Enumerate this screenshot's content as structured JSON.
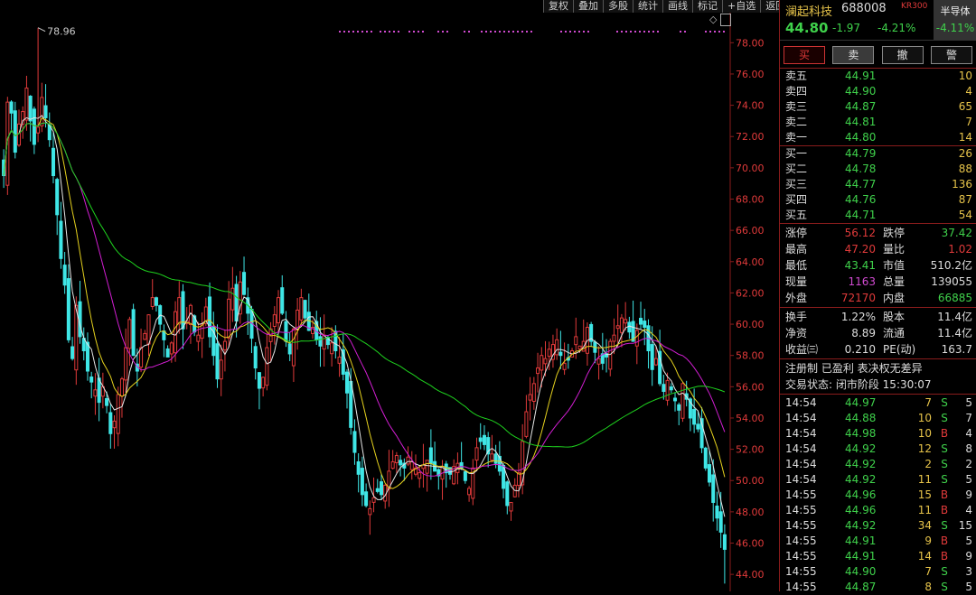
{
  "toolbar": [
    "复权",
    "叠加",
    "多股",
    "统计",
    "画线",
    "标记",
    "+自选",
    "返回"
  ],
  "chart_data": {
    "type": "candlestick",
    "y_ticks": [
      "78.00",
      "76.00",
      "74.00",
      "72.00",
      "70.00",
      "68.00",
      "66.00",
      "64.00",
      "62.00",
      "60.00",
      "58.00",
      "56.00",
      "54.00",
      "52.00",
      "50.00",
      "48.00",
      "46.00",
      "44.00"
    ],
    "ylim": [
      43.2,
      79.0
    ],
    "high_label": "78.96",
    "close": [
      69.5,
      74.2,
      73.5,
      71.0,
      72.8,
      73.6,
      75.1,
      73.0,
      71.5,
      72.6,
      74.5,
      73.2,
      71.8,
      69.5,
      67.0,
      64.2,
      62.5,
      59.0,
      57.8,
      61.2,
      59.2,
      58.3,
      57.0,
      56.3,
      55.8,
      55.0,
      56.0,
      54.8,
      53.0,
      53.8,
      55.5,
      56.5,
      58.5,
      60.3,
      58.0,
      57.0,
      58.5,
      59.4,
      60.6,
      61.7,
      61.2,
      60.0,
      59.0,
      57.9,
      58.8,
      60.8,
      61.7,
      59.7,
      60.2,
      61.2,
      59.5,
      59.3,
      60.0,
      61.1,
      59.2,
      58.0,
      56.5,
      57.7,
      58.9,
      61.6,
      62.3,
      60.2,
      62.7,
      61.9,
      60.7,
      59.1,
      57.2,
      55.9,
      56.6,
      58.5,
      59.7,
      60.6,
      61.7,
      60.7,
      58.9,
      58.1,
      59.7,
      60.9,
      61.7,
      60.4,
      59.6,
      59.8,
      59.0,
      58.6,
      59.3,
      58.7,
      58.8,
      58.3,
      57.9,
      56.8,
      55.6,
      53.4,
      51.8,
      50.4,
      49.1,
      48.4,
      48.2,
      48.9,
      49.3,
      49.1,
      49.7,
      50.6,
      51.2,
      51.6,
      51.0,
      50.8,
      51.5,
      51.2,
      50.8,
      50.5,
      51.0,
      51.3,
      51.1,
      50.6,
      50.3,
      50.9,
      50.5,
      50.4,
      50.9,
      51.1,
      50.8,
      50.0,
      49.5,
      50.8,
      52.1,
      52.5,
      52.3,
      51.7,
      51.7,
      51.1,
      50.6,
      49.5,
      48.4,
      48.6,
      49.7,
      50.5,
      52.5,
      54.4,
      55.5,
      56.2,
      57.2,
      58.0,
      57.8,
      58.4,
      58.7,
      59.0,
      58.0,
      57.5,
      57.7,
      58.3,
      59.2,
      58.6,
      58.9,
      59.8,
      58.9,
      58.2,
      57.8,
      57.5,
      57.9,
      58.9,
      59.3,
      59.9,
      60.4,
      60.3,
      59.5,
      58.9,
      59.6,
      60.0,
      59.8,
      58.3,
      57.1,
      57.8,
      56.2,
      55.7,
      56.4,
      55.8,
      55.1,
      54.5,
      56.2,
      55.2,
      54.0,
      53.6,
      53.3,
      52.1,
      50.8,
      49.9,
      48.6,
      47.6,
      46.7,
      45.6
    ],
    "ma_colors": {
      "ma5": "#e6e6e6",
      "ma10": "#e6d21e",
      "ma20": "#d21ed2",
      "ma60": "#1ed21e"
    },
    "colors": {
      "up": "#e03a3a",
      "down": "#3fe6e6"
    }
  },
  "panel": {
    "name": "澜起科技",
    "code": "688008",
    "tag": "KR300",
    "sector_name": "半导体",
    "sector_pct": "-4.11%",
    "price": "44.80",
    "change": "-1.97",
    "pct": "-4.21%",
    "buttons": [
      "买",
      "卖",
      "撤",
      "警"
    ],
    "asks": [
      {
        "label": "卖五",
        "price": "44.91",
        "vol": "10"
      },
      {
        "label": "卖四",
        "price": "44.90",
        "vol": "4"
      },
      {
        "label": "卖三",
        "price": "44.87",
        "vol": "65"
      },
      {
        "label": "卖二",
        "price": "44.81",
        "vol": "7"
      },
      {
        "label": "卖一",
        "price": "44.80",
        "vol": "14"
      }
    ],
    "bids": [
      {
        "label": "买一",
        "price": "44.79",
        "vol": "26"
      },
      {
        "label": "买二",
        "price": "44.78",
        "vol": "88"
      },
      {
        "label": "买三",
        "price": "44.77",
        "vol": "136"
      },
      {
        "label": "买四",
        "price": "44.76",
        "vol": "87"
      },
      {
        "label": "买五",
        "price": "44.71",
        "vol": "54"
      }
    ],
    "stats1": [
      {
        "k": "涨停",
        "v": "56.12",
        "c": "red",
        "k2": "跌停",
        "v2": "37.42",
        "c2": "green"
      },
      {
        "k": "最高",
        "v": "47.20",
        "c": "red",
        "k2": "量比",
        "v2": "1.02",
        "c2": "red"
      },
      {
        "k": "最低",
        "v": "43.41",
        "c": "green",
        "k2": "市值",
        "v2": "510.2亿",
        "c2": "white"
      },
      {
        "k": "现量",
        "v": "1163",
        "c": "purple",
        "k2": "总量",
        "v2": "139055",
        "c2": "white"
      },
      {
        "k": "外盘",
        "v": "72170",
        "c": "red",
        "k2": "内盘",
        "v2": "66885",
        "c2": "green"
      }
    ],
    "stats2": [
      {
        "k": "换手",
        "v": "1.22%",
        "c": "white",
        "k2": "股本",
        "v2": "11.4亿",
        "c2": "white"
      },
      {
        "k": "净资",
        "v": "8.89",
        "c": "white",
        "k2": "流通",
        "v2": "11.4亿",
        "c2": "white"
      },
      {
        "k": "收益㈢",
        "v": "0.210",
        "c": "white",
        "k2": "PE(动)",
        "v2": "163.7",
        "c2": "white"
      }
    ],
    "info1": "注册制 已盈利 表决权无差异",
    "info2": "交易状态: 闭市阶段 15:30:07",
    "trades": [
      {
        "t": "14:54",
        "p": "44.97",
        "v": "7",
        "d": "S",
        "n": "5"
      },
      {
        "t": "14:54",
        "p": "44.88",
        "v": "10",
        "d": "S",
        "n": "7"
      },
      {
        "t": "14:54",
        "p": "44.98",
        "v": "10",
        "d": "B",
        "n": "4"
      },
      {
        "t": "14:54",
        "p": "44.92",
        "v": "12",
        "d": "S",
        "n": "8"
      },
      {
        "t": "14:54",
        "p": "44.92",
        "v": "2",
        "d": "S",
        "n": "2"
      },
      {
        "t": "14:54",
        "p": "44.92",
        "v": "11",
        "d": "S",
        "n": "5"
      },
      {
        "t": "14:55",
        "p": "44.96",
        "v": "15",
        "d": "B",
        "n": "9"
      },
      {
        "t": "14:55",
        "p": "44.96",
        "v": "11",
        "d": "B",
        "n": "4"
      },
      {
        "t": "14:55",
        "p": "44.92",
        "v": "34",
        "d": "S",
        "n": "15"
      },
      {
        "t": "14:55",
        "p": "44.91",
        "v": "9",
        "d": "B",
        "n": "5"
      },
      {
        "t": "14:55",
        "p": "44.91",
        "v": "14",
        "d": "B",
        "n": "9"
      },
      {
        "t": "14:55",
        "p": "44.90",
        "v": "7",
        "d": "S",
        "n": "3"
      },
      {
        "t": "14:55",
        "p": "44.87",
        "v": "8",
        "d": "S",
        "n": "5"
      }
    ]
  }
}
